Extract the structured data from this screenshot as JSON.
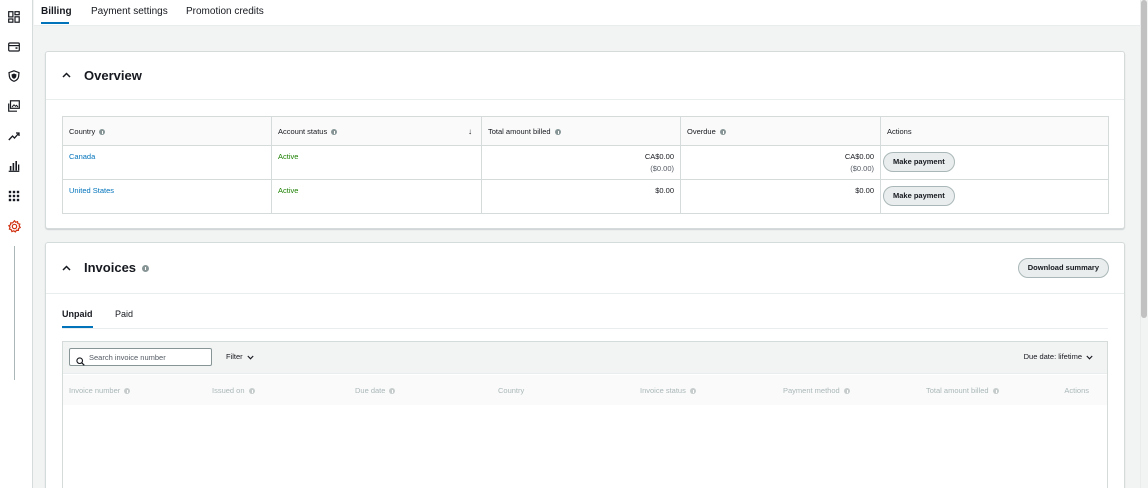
{
  "top_tabs": [
    {
      "label": "Billing",
      "active": true
    },
    {
      "label": "Payment settings",
      "active": false
    },
    {
      "label": "Promotion credits",
      "active": false
    }
  ],
  "rail_icons": [
    "dashboard-icon",
    "wallet-icon",
    "shield-icon",
    "gallery-icon",
    "trend-icon",
    "bar-chart-icon",
    "grid-icon",
    "gear-icon"
  ],
  "overview": {
    "title": "Overview",
    "columns": [
      "Country",
      "Account status",
      "Total amount billed",
      "Overdue",
      "Actions"
    ],
    "rows": [
      {
        "country": "Canada",
        "status": "Active",
        "billed": "CA$0.00",
        "billed_sub": "($0.00)",
        "overdue": "CA$0.00",
        "overdue_sub": "($0.00)",
        "action": "Make payment"
      },
      {
        "country": "United States",
        "status": "Active",
        "billed": "$0.00",
        "billed_sub": "",
        "overdue": "$0.00",
        "overdue_sub": "",
        "action": "Make payment"
      }
    ]
  },
  "invoices": {
    "title": "Invoices",
    "download_label": "Download summary",
    "tabs": [
      {
        "label": "Unpaid",
        "active": true
      },
      {
        "label": "Paid",
        "active": false
      }
    ],
    "search_placeholder": "Search invoice number",
    "filter_label": "Filter",
    "due_date_label": "Due date: lifetime",
    "columns": [
      {
        "label": "Invoice number",
        "info": true
      },
      {
        "label": "Issued on",
        "info": true
      },
      {
        "label": "Due date",
        "info": true
      },
      {
        "label": "Country",
        "info": false
      },
      {
        "label": "Invoice status",
        "info": true
      },
      {
        "label": "Payment method",
        "info": true
      },
      {
        "label": "Total amount billed",
        "info": true
      },
      {
        "label": "Actions",
        "info": false
      }
    ]
  },
  "colors": {
    "accent": "#0073bb",
    "active_status": "#1d8102",
    "highlight_icon": "#d13212"
  }
}
